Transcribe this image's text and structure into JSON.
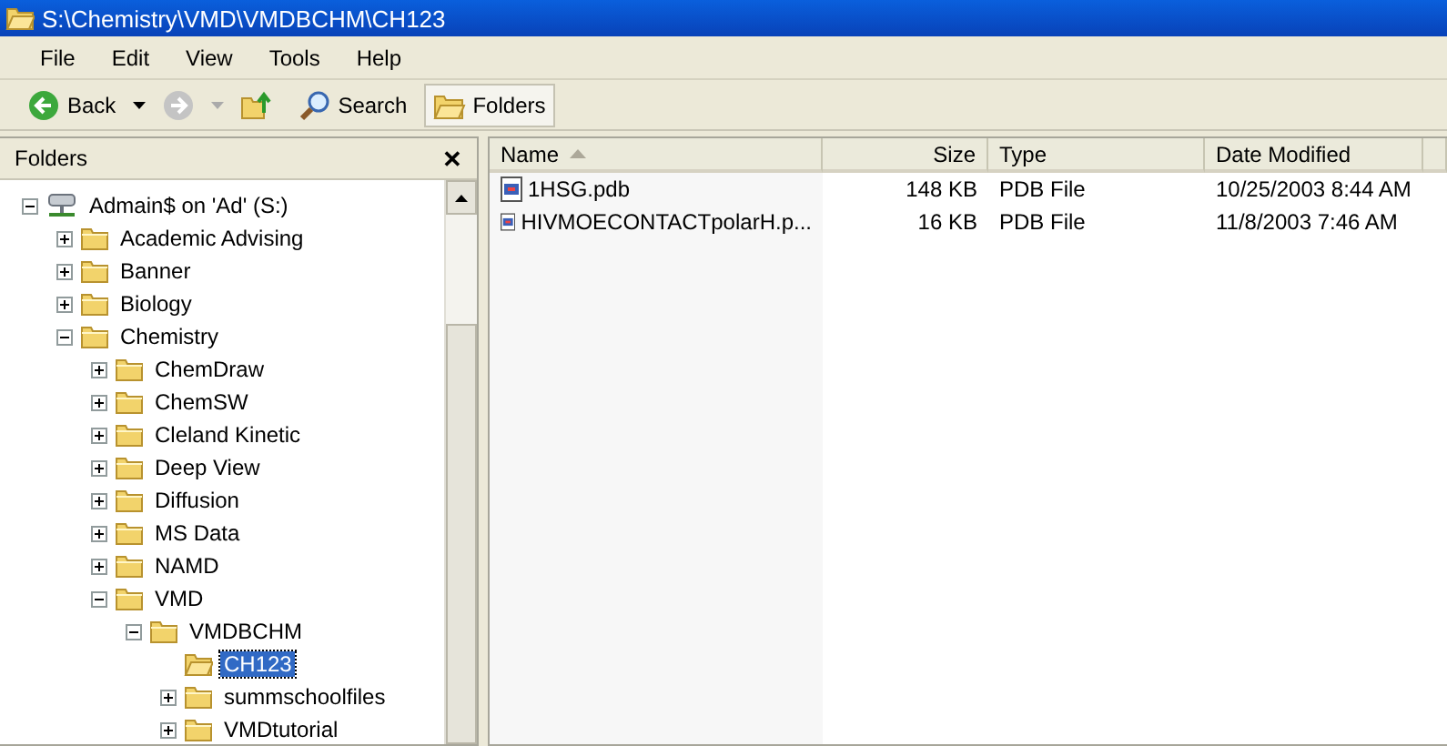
{
  "window": {
    "title": "S:\\Chemistry\\VMD\\VMDBCHM\\CH123"
  },
  "menu": [
    "File",
    "Edit",
    "View",
    "Tools",
    "Help"
  ],
  "toolbar": [
    {
      "kind": "back",
      "label": "Back",
      "disabled": false,
      "selected": false
    },
    {
      "kind": "forward",
      "disabled": true,
      "selected": false
    },
    {
      "kind": "up",
      "selected": false
    },
    {
      "kind": "search",
      "label": "Search",
      "selected": false
    },
    {
      "kind": "folders",
      "label": "Folders",
      "selected": true
    }
  ],
  "sidebar": {
    "title": "Folders",
    "close": "✕",
    "tree": [
      {
        "label": "Admain$ on 'Ad' (S:)",
        "kind": "drive",
        "expanded": true,
        "selected": false,
        "children": [
          {
            "label": "Academic Advising",
            "expanded": false,
            "selected": false
          },
          {
            "label": "Banner",
            "expanded": false,
            "selected": false
          },
          {
            "label": "Biology",
            "expanded": false,
            "selected": false
          },
          {
            "label": "Chemistry",
            "expanded": true,
            "selected": false,
            "children": [
              {
                "label": "ChemDraw",
                "expanded": false,
                "selected": false
              },
              {
                "label": "ChemSW",
                "expanded": false,
                "selected": false
              },
              {
                "label": "Cleland Kinetic",
                "expanded": false,
                "selected": false
              },
              {
                "label": "Deep View",
                "expanded": false,
                "selected": false
              },
              {
                "label": "Diffusion",
                "expanded": false,
                "selected": false
              },
              {
                "label": "MS Data",
                "expanded": false,
                "selected": false
              },
              {
                "label": "NAMD",
                "expanded": false,
                "selected": false
              },
              {
                "label": "VMD",
                "expanded": true,
                "selected": false,
                "children": [
                  {
                    "label": "VMDBCHM",
                    "expanded": true,
                    "selected": false,
                    "children": [
                      {
                        "label": "CH123",
                        "selected": true
                      },
                      {
                        "label": "summschoolfiles",
                        "expanded": false,
                        "selected": false
                      },
                      {
                        "label": "VMDtutorial",
                        "expanded": false,
                        "selected": false
                      }
                    ]
                  }
                ]
              }
            ]
          }
        ]
      }
    ]
  },
  "table": {
    "columns": [
      {
        "label": "Name",
        "sorted": true,
        "kind": "text"
      },
      {
        "label": "Size",
        "sorted": false,
        "kind": "number"
      },
      {
        "label": "Type",
        "sorted": false,
        "kind": "text"
      },
      {
        "label": "Date Modified",
        "sorted": false,
        "kind": "text"
      }
    ],
    "rows": [
      [
        "1HSG.pdb",
        "148 KB",
        "PDB File",
        "10/25/2003 8:44 AM"
      ],
      [
        "HIVMOECONTACTpolarH.p...",
        "16 KB",
        "PDB File",
        "11/8/2003 7:46 AM"
      ]
    ]
  }
}
